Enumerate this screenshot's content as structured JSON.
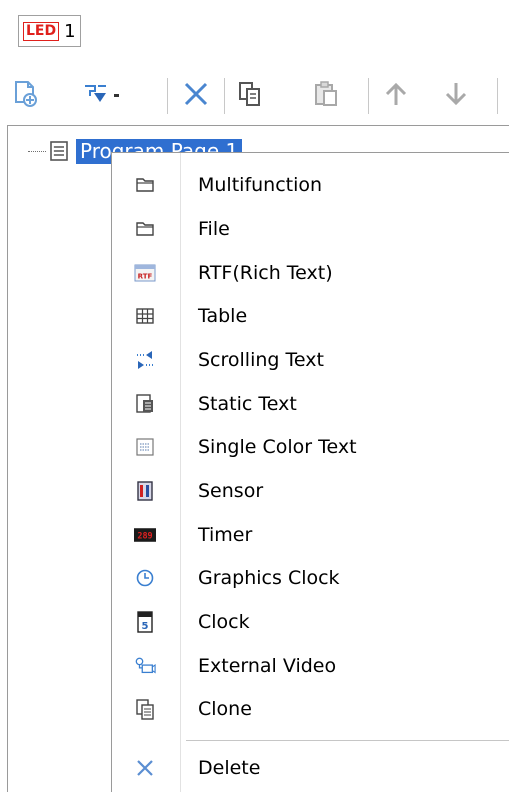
{
  "led_tab": {
    "badge": "LED",
    "number": "1"
  },
  "toolbar": {
    "buttons": [
      {
        "icon": "add-page-icon"
      },
      {
        "icon": "add-program-dropdown-icon"
      },
      {
        "icon": "delete-icon"
      },
      {
        "icon": "copy-icon"
      },
      {
        "icon": "paste-icon"
      },
      {
        "icon": "move-up-icon"
      },
      {
        "icon": "move-down-icon"
      }
    ]
  },
  "tree": {
    "selected_node": "Program Page 1"
  },
  "menu": {
    "items": [
      {
        "label": "Multifunction",
        "icon": "folder-icon"
      },
      {
        "label": "File",
        "icon": "folder-icon"
      },
      {
        "label": "RTF(Rich Text)",
        "icon": "rtf-icon",
        "icon_text": "RTF"
      },
      {
        "label": "Table",
        "icon": "table-icon"
      },
      {
        "label": "Scrolling Text",
        "icon": "scrolling-text-icon"
      },
      {
        "label": "Static Text",
        "icon": "static-text-icon"
      },
      {
        "label": "Single Color Text",
        "icon": "single-color-text-icon"
      },
      {
        "label": "Sensor",
        "icon": "sensor-icon"
      },
      {
        "label": "Timer",
        "icon": "timer-icon",
        "icon_text": "289"
      },
      {
        "label": "Graphics Clock",
        "icon": "graphics-clock-icon"
      },
      {
        "label": "Clock",
        "icon": "clock-icon",
        "icon_text": "5"
      },
      {
        "label": "External Video",
        "icon": "external-video-icon"
      },
      {
        "label": "Clone",
        "icon": "clone-icon"
      },
      {
        "label": "Delete",
        "icon": "delete-icon"
      }
    ]
  },
  "colors": {
    "selection": "#2f6fd0",
    "icon_blue": "#3a7fd0",
    "led_red": "#e0201c"
  }
}
